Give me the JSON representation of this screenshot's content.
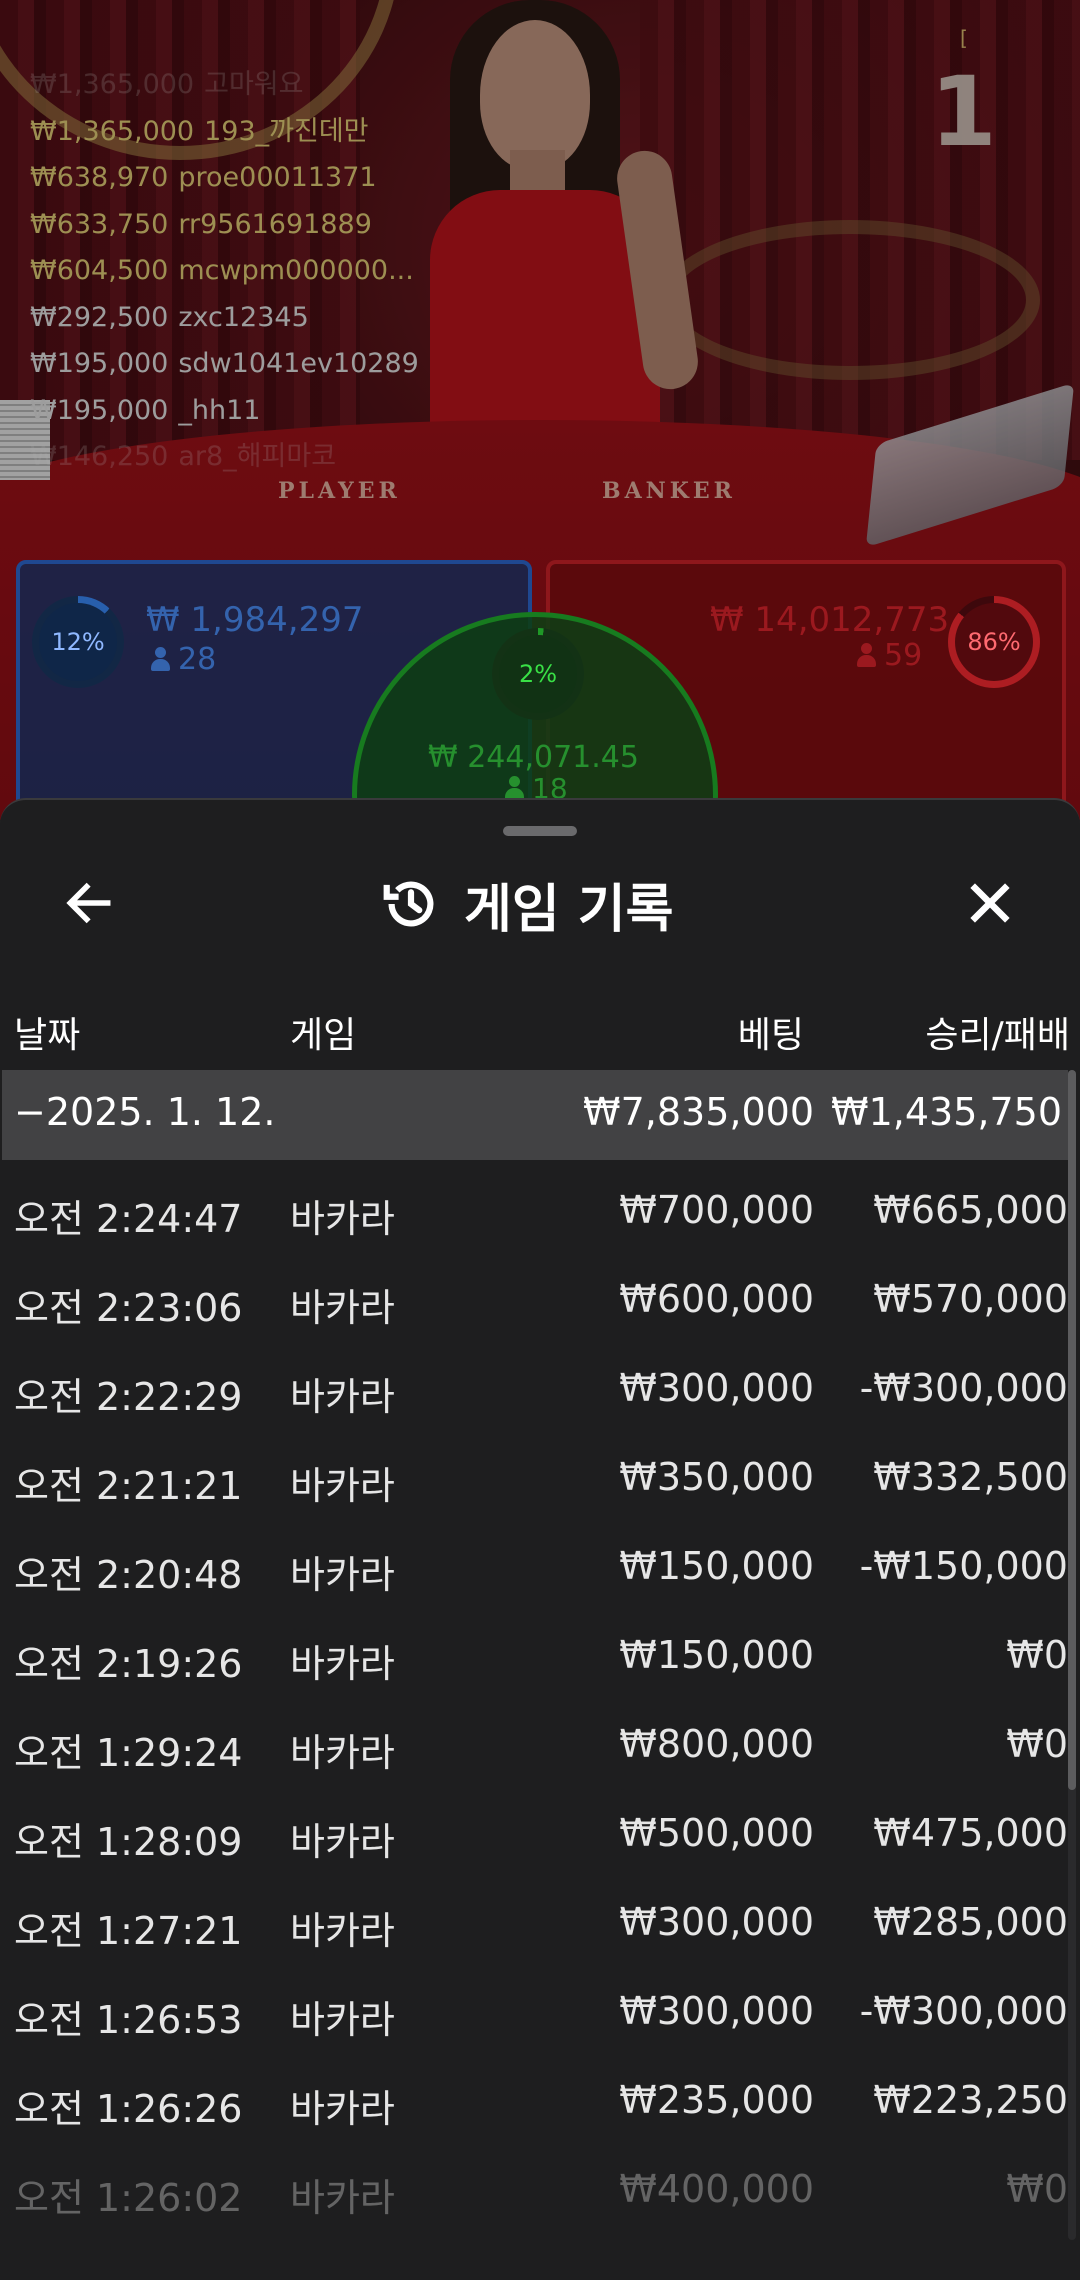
{
  "game_view": {
    "round_number": "1",
    "round_marker": "[",
    "table_labels": {
      "player": "PLAYER",
      "banker": "BANKER"
    },
    "winners": [
      {
        "amount": "₩1,365,000",
        "user": "고마워요",
        "style": "fade2"
      },
      {
        "amount": "₩1,365,000",
        "user": "193_까진데만",
        "style": "gold"
      },
      {
        "amount": "₩638,970",
        "user": "proe00011371",
        "style": "gold"
      },
      {
        "amount": "₩633,750",
        "user": "rr9561691889",
        "style": "gold"
      },
      {
        "amount": "₩604,500",
        "user": "mcwpm000000...",
        "style": "gold"
      },
      {
        "amount": "₩292,500",
        "user": "zxc12345",
        "style": "white"
      },
      {
        "amount": "₩195,000",
        "user": "sdw1041ev10289",
        "style": "white"
      },
      {
        "amount": "₩195,000",
        "user": "_hh11",
        "style": "white"
      },
      {
        "amount": "₩146,250",
        "user": "ar8_해피마코",
        "style": "fade2"
      }
    ],
    "player_zone": {
      "percent": "12%",
      "amount": "₩ 1,984,297",
      "count": "28"
    },
    "banker_zone": {
      "percent": "86%",
      "amount": "₩ 14,012,773",
      "count": "59"
    },
    "tie_zone": {
      "percent": "2%",
      "amount": "₩ 244,071.45",
      "count": "18"
    }
  },
  "sheet": {
    "title": "게임 기록",
    "icons": {
      "back": "arrow-left-icon",
      "history": "history-icon",
      "close": "close-icon"
    },
    "columns": {
      "date": "날짜",
      "game": "게임",
      "bet": "베팅",
      "result": "승리/패배"
    },
    "date_group": {
      "label": "−2025. 1. 12.",
      "bet_total": "₩7,835,000",
      "result_total": "₩1,435,750"
    },
    "rows": [
      {
        "time": "오전 2:24:47",
        "game": "바카라",
        "bet": "₩700,000",
        "result": "₩665,000"
      },
      {
        "time": "오전 2:23:06",
        "game": "바카라",
        "bet": "₩600,000",
        "result": "₩570,000"
      },
      {
        "time": "오전 2:22:29",
        "game": "바카라",
        "bet": "₩300,000",
        "result": "-₩300,000"
      },
      {
        "time": "오전 2:21:21",
        "game": "바카라",
        "bet": "₩350,000",
        "result": "₩332,500"
      },
      {
        "time": "오전 2:20:48",
        "game": "바카라",
        "bet": "₩150,000",
        "result": "-₩150,000"
      },
      {
        "time": "오전 2:19:26",
        "game": "바카라",
        "bet": "₩150,000",
        "result": "₩0"
      },
      {
        "time": "오전 1:29:24",
        "game": "바카라",
        "bet": "₩800,000",
        "result": "₩0"
      },
      {
        "time": "오전 1:28:09",
        "game": "바카라",
        "bet": "₩500,000",
        "result": "₩475,000"
      },
      {
        "time": "오전 1:27:21",
        "game": "바카라",
        "bet": "₩300,000",
        "result": "₩285,000"
      },
      {
        "time": "오전 1:26:53",
        "game": "바카라",
        "bet": "₩300,000",
        "result": "-₩300,000"
      },
      {
        "time": "오전 1:26:26",
        "game": "바카라",
        "bet": "₩235,000",
        "result": "₩223,250"
      },
      {
        "time": "오전 1:26:02",
        "game": "바카라",
        "bet": "₩400,000",
        "result": "₩0"
      }
    ]
  },
  "colors": {
    "sheet_bg": "#1e1e1f",
    "date_group_bg": "#424244",
    "player_blue": "#4d92ff",
    "banker_red": "#e5262e",
    "tie_green": "#39d545",
    "winner_gold": "#e8d37a"
  }
}
